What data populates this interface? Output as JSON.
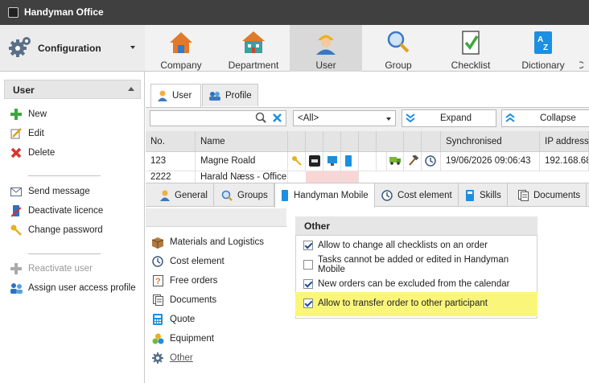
{
  "app": {
    "title": "Handyman Office"
  },
  "left": {
    "config_label": "Configuration",
    "section_title": "User",
    "actions": [
      {
        "label": "New",
        "icon": "plus-icon"
      },
      {
        "label": "Edit",
        "icon": "edit-icon"
      },
      {
        "label": "Delete",
        "icon": "delete-icon"
      },
      {
        "label": "Send message",
        "icon": "envelope-icon"
      },
      {
        "label": "Deactivate licence",
        "icon": "phone-licence-icon"
      },
      {
        "label": "Change password",
        "icon": "key-icon"
      },
      {
        "label": "Reactivate user",
        "icon": "plus-icon"
      },
      {
        "label": "Assign user access profile",
        "icon": "users-icon"
      }
    ]
  },
  "ribbon": {
    "tabs": [
      {
        "label": "Company",
        "icon": "house-icon"
      },
      {
        "label": "Department",
        "icon": "department-icon"
      },
      {
        "label": "User",
        "icon": "worker-icon",
        "selected": true
      },
      {
        "label": "Group",
        "icon": "magnifier-icon"
      },
      {
        "label": "Checklist",
        "icon": "checklist-icon"
      },
      {
        "label": "Dictionary",
        "icon": "dictionary-icon"
      },
      {
        "label": "C",
        "icon": "cut-off-icon"
      }
    ]
  },
  "panel_tabs": [
    {
      "label": "User",
      "icon": "user-icon"
    },
    {
      "label": "Profile",
      "icon": "profile-icon"
    }
  ],
  "filter": {
    "search_value": "",
    "select_value": "<All>",
    "expand_label": "Expand",
    "collapse_label": "Collapse"
  },
  "grid": {
    "headers": [
      "No.",
      "Name",
      "Synchronised",
      "IP address"
    ],
    "rows": [
      {
        "no": "123",
        "name": "Magne Roald",
        "synchronised": "19/06/2026 09:06:43",
        "ip": "192.168.68"
      },
      {
        "no": "2222",
        "name": "Harald Næss - Office",
        "synchronised": "",
        "ip": ""
      }
    ]
  },
  "lower_tabs": [
    {
      "label": "General",
      "icon": "user-icon"
    },
    {
      "label": "Groups",
      "icon": "magnifier-icon"
    },
    {
      "label": "Handyman Mobile",
      "icon": "phone-icon",
      "selected": true
    },
    {
      "label": "Cost element",
      "icon": "clock-icon"
    },
    {
      "label": "Skills",
      "icon": "book-icon"
    },
    {
      "label": "Documents",
      "icon": "documents-icon"
    }
  ],
  "categories": [
    {
      "label": "Materials and Logistics",
      "icon": "box-icon"
    },
    {
      "label": "Cost element",
      "icon": "clock-icon"
    },
    {
      "label": "Free orders",
      "icon": "question-icon"
    },
    {
      "label": "Documents",
      "icon": "documents-icon"
    },
    {
      "label": "Quote",
      "icon": "calculator-icon"
    },
    {
      "label": "Equipment",
      "icon": "equipment-icon"
    },
    {
      "label": "Other",
      "icon": "gear-icon",
      "selected": true
    }
  ],
  "other": {
    "title": "Other",
    "options": [
      {
        "label": "Allow to change all checklists on an order",
        "checked": true
      },
      {
        "label": "Tasks cannot be added or edited in Handyman Mobile",
        "checked": false
      },
      {
        "label": "New orders can be excluded from the calendar",
        "checked": true
      },
      {
        "label": "Allow to transfer order to other participant",
        "checked": true,
        "highlighted": true
      }
    ]
  },
  "colors": {
    "titlebar": "#404040",
    "highlight": "#faf67a",
    "selected_tab": "#d9d9d9",
    "link": "#1a4e9a"
  }
}
